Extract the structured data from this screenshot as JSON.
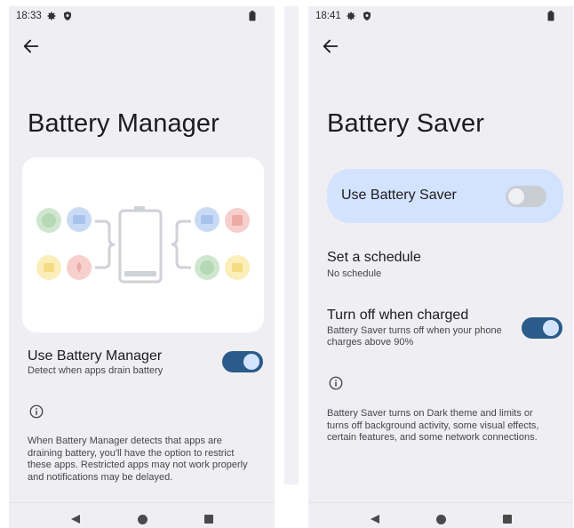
{
  "left_screen": {
    "status_time": "18:33",
    "title": "Battery Manager",
    "toggle_row": {
      "title": "Use Battery Manager",
      "subtitle": "Detect when apps drain battery",
      "enabled": true
    },
    "footer_line1": "When Battery Manager detects that apps are",
    "footer_line2": "draining battery, you'll have the option to restrict",
    "footer_line3": "these apps. Restricted apps may not work properly",
    "footer_line4": "and notifications may be delayed."
  },
  "right_screen": {
    "status_time": "18:41",
    "title": "Battery Saver",
    "main_toggle": {
      "label": "Use Battery Saver",
      "enabled": false
    },
    "schedule_row": {
      "title": "Set a schedule",
      "subtitle": "No schedule"
    },
    "charged_row": {
      "title": "Turn off when charged",
      "subtitle_line1": "Battery Saver turns off when your phone",
      "subtitle_line2": "charges above 90%",
      "enabled": true
    },
    "footer_line1": "Battery Saver turns on Dark theme and limits or",
    "footer_line2": "turns off background activity, some visual effects,",
    "footer_line3": "certain features, and some network connections."
  },
  "colors": {
    "background": "#efeef2",
    "accent": "#2a5b8a",
    "card_highlight": "#d3e3fd"
  },
  "icons": [
    "gear-icon",
    "shield-icon",
    "battery-icon",
    "back-arrow-icon",
    "info-icon",
    "nav-back-icon",
    "nav-home-icon",
    "nav-recents-icon"
  ]
}
